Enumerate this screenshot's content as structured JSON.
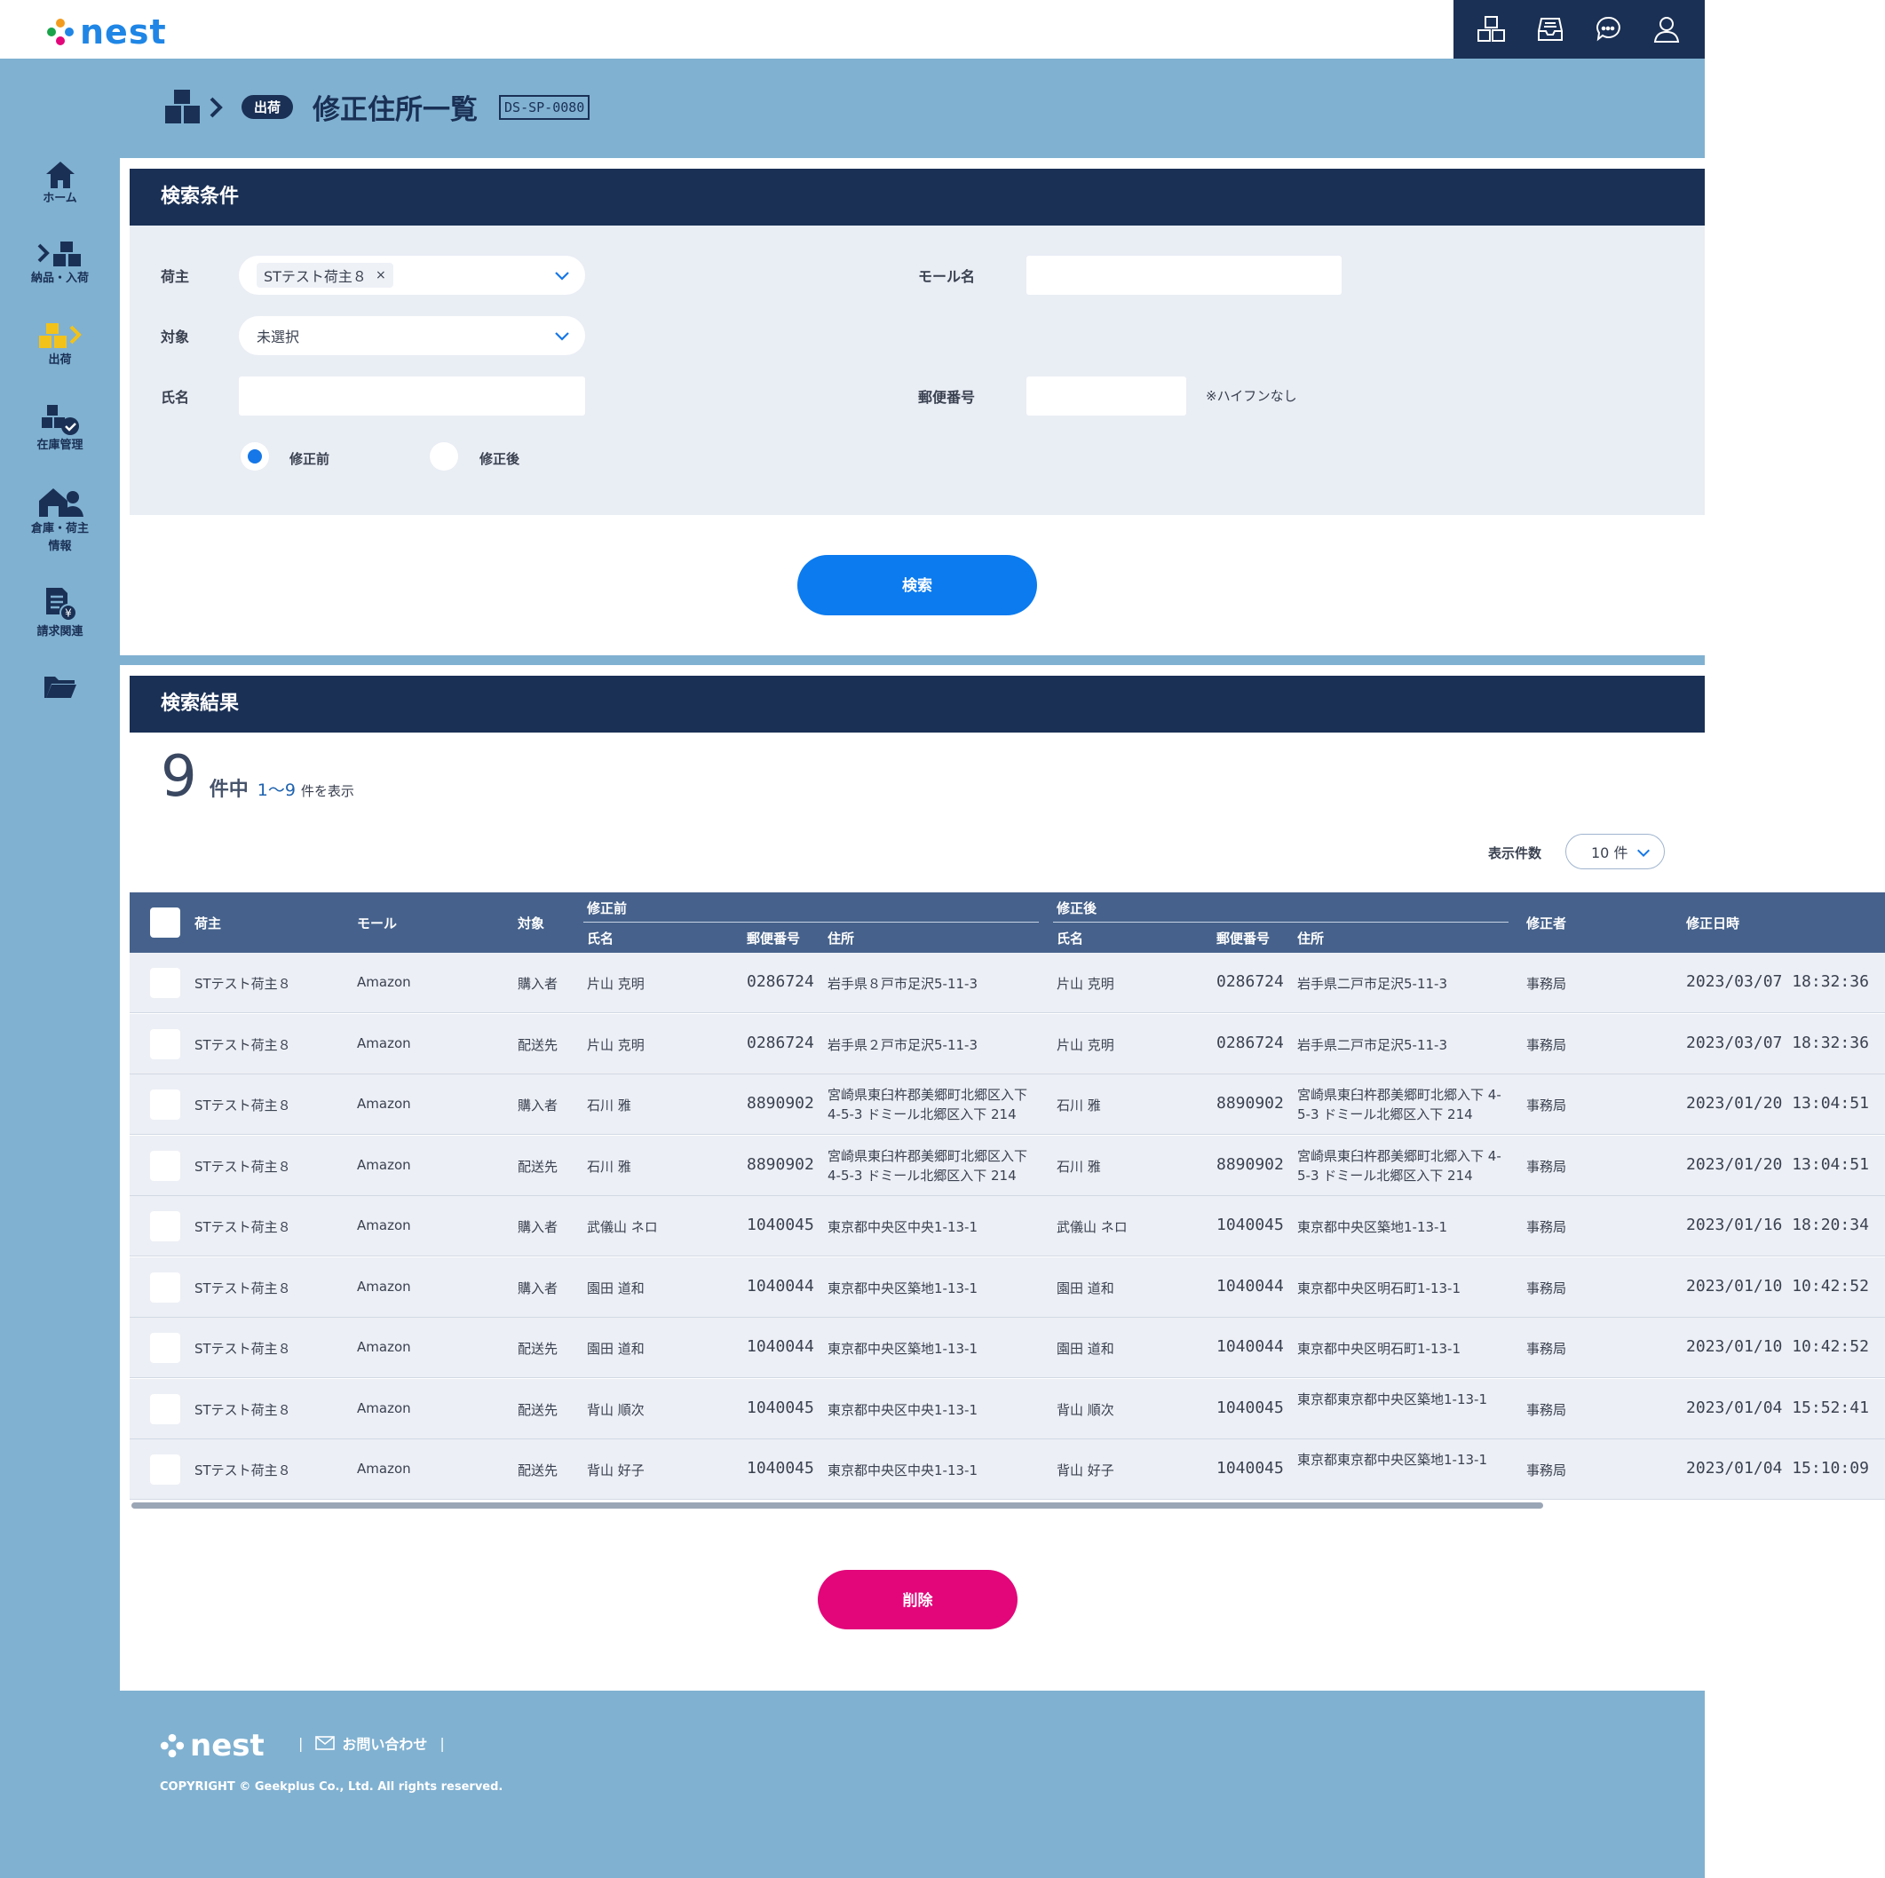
{
  "app": {
    "logo": "nest"
  },
  "header_icons": [
    "boxes-icon",
    "inbox-icon",
    "chat-icon",
    "user-icon"
  ],
  "sidebar": {
    "items": [
      {
        "label": "ホーム",
        "icon": "home-icon"
      },
      {
        "label": "納品・入荷",
        "icon": "inbound-icon"
      },
      {
        "label": "出荷",
        "icon": "outbound-icon"
      },
      {
        "label": "在庫管理",
        "icon": "inventory-icon"
      },
      {
        "label": "倉庫・荷主",
        "label2": "情報",
        "icon": "warehouse-icon"
      },
      {
        "label": "請求関連",
        "icon": "billing-icon"
      },
      {
        "label": "",
        "icon": "folder-icon"
      }
    ]
  },
  "breadcrumb": {
    "section": "出荷",
    "title": "修正住所一覧",
    "screen_id": "DS-SP-0080"
  },
  "search": {
    "heading": "検索条件",
    "shipper_label": "荷主",
    "shipper_chip": "STテスト荷主８",
    "chip_remove": "×",
    "mall_label": "モール名",
    "mall_value": "",
    "target_label": "対象",
    "target_value": "未選択",
    "name_label": "氏名",
    "name_value": "",
    "postal_label": "郵便番号",
    "postal_value": "",
    "postal_note": "※ハイフンなし",
    "radio_before": "修正前",
    "radio_after": "修正後",
    "radio_selected": "before",
    "submit": "検索"
  },
  "results": {
    "heading": "検索結果",
    "total": "9",
    "unit": "件中",
    "range": "1～9",
    "suffix": "件を表示",
    "per_page_label": "表示件数",
    "per_page_value": "10 件",
    "columns": {
      "shipper": "荷主",
      "mall": "モール",
      "target": "対象",
      "before_group": "修正前",
      "after_group": "修正後",
      "name": "氏名",
      "postal": "郵便番号",
      "address": "住所",
      "editor": "修正者",
      "edited_at": "修正日時"
    },
    "rows": [
      {
        "shipper": "STテスト荷主８",
        "mall": "Amazon",
        "target": "購入者",
        "b_name": "片山 克明",
        "b_postal": "0286724",
        "b_addr": "岩手県８戸市足沢5-11-3",
        "a_name": "片山 克明",
        "a_postal": "0286724",
        "a_addr": "岩手県二戸市足沢5-11-3",
        "editor": "事務局",
        "edited_at": "2023/03/07  18:32:36"
      },
      {
        "shipper": "STテスト荷主８",
        "mall": "Amazon",
        "target": "配送先",
        "b_name": "片山 克明",
        "b_postal": "0286724",
        "b_addr": "岩手県２戸市足沢5-11-3",
        "a_name": "片山 克明",
        "a_postal": "0286724",
        "a_addr": "岩手県二戸市足沢5-11-3",
        "editor": "事務局",
        "edited_at": "2023/03/07  18:32:36"
      },
      {
        "shipper": "STテスト荷主８",
        "mall": "Amazon",
        "target": "購入者",
        "b_name": "石川 雅",
        "b_postal": "8890902",
        "b_addr": "宮崎県東臼杵郡美郷町北郷区入下 4-5-3 ドミール北郷区入下 214",
        "a_name": "石川 雅",
        "a_postal": "8890902",
        "a_addr": "宮崎県東臼杵郡美郷町北郷入下 4-5-3 ドミール北郷区入下 214",
        "editor": "事務局",
        "edited_at": "2023/01/20  13:04:51"
      },
      {
        "shipper": "STテスト荷主８",
        "mall": "Amazon",
        "target": "配送先",
        "b_name": "石川 雅",
        "b_postal": "8890902",
        "b_addr": "宮崎県東臼杵郡美郷町北郷区入下 4-5-3 ドミール北郷区入下 214",
        "a_name": "石川 雅",
        "a_postal": "8890902",
        "a_addr": "宮崎県東臼杵郡美郷町北郷入下 4-5-3 ドミール北郷区入下 214",
        "editor": "事務局",
        "edited_at": "2023/01/20  13:04:51"
      },
      {
        "shipper": "STテスト荷主８",
        "mall": "Amazon",
        "target": "購入者",
        "b_name": "武儀山 ネロ",
        "b_postal": "1040045",
        "b_addr": "東京都中央区中央1-13-1",
        "a_name": "武儀山 ネロ",
        "a_postal": "1040045",
        "a_addr": "東京都中央区築地1-13-1",
        "editor": "事務局",
        "edited_at": "2023/01/16  18:20:34"
      },
      {
        "shipper": "STテスト荷主８",
        "mall": "Amazon",
        "target": "購入者",
        "b_name": "園田 道和",
        "b_postal": "1040044",
        "b_addr": "東京都中央区築地1-13-1",
        "a_name": "園田 道和",
        "a_postal": "1040044",
        "a_addr": "東京都中央区明石町1-13-1",
        "editor": "事務局",
        "edited_at": "2023/01/10  10:42:52"
      },
      {
        "shipper": "STテスト荷主８",
        "mall": "Amazon",
        "target": "配送先",
        "b_name": "園田 道和",
        "b_postal": "1040044",
        "b_addr": "東京都中央区築地1-13-1",
        "a_name": "園田 道和",
        "a_postal": "1040044",
        "a_addr": "東京都中央区明石町1-13-1",
        "editor": "事務局",
        "edited_at": "2023/01/10  10:42:52"
      },
      {
        "shipper": "STテスト荷主８",
        "mall": "Amazon",
        "target": "配送先",
        "b_name": "背山 順次",
        "b_postal": "1040045",
        "b_addr": "東京都中央区中央1-13-1",
        "a_name": "背山 順次",
        "a_postal": "1040045",
        "a_addr": "東京都東京都中央区築地1-13-1",
        "editor": "事務局",
        "edited_at": "2023/01/04  15:52:41"
      },
      {
        "shipper": "STテスト荷主８",
        "mall": "Amazon",
        "target": "配送先",
        "b_name": "背山 好子",
        "b_postal": "1040045",
        "b_addr": "東京都中央区中央1-13-1",
        "a_name": "背山 好子",
        "a_postal": "1040045",
        "a_addr": "東京都東京都中央区築地1-13-1",
        "editor": "事務局",
        "edited_at": "2023/01/04  15:10:09"
      }
    ],
    "delete": "削除"
  },
  "footer": {
    "logo": "nest",
    "contact": "お問い合わせ",
    "separator": "|",
    "copyright": "COPYRIGHT © Geekplus Co., Ltd. All rights reserved."
  },
  "colors": {
    "navy": "#1a3055",
    "page_bg": "#80b1d1",
    "primary": "#0b7bef",
    "danger": "#e2067a",
    "table_head": "#46628c",
    "active_nav": "#f2c21b"
  }
}
